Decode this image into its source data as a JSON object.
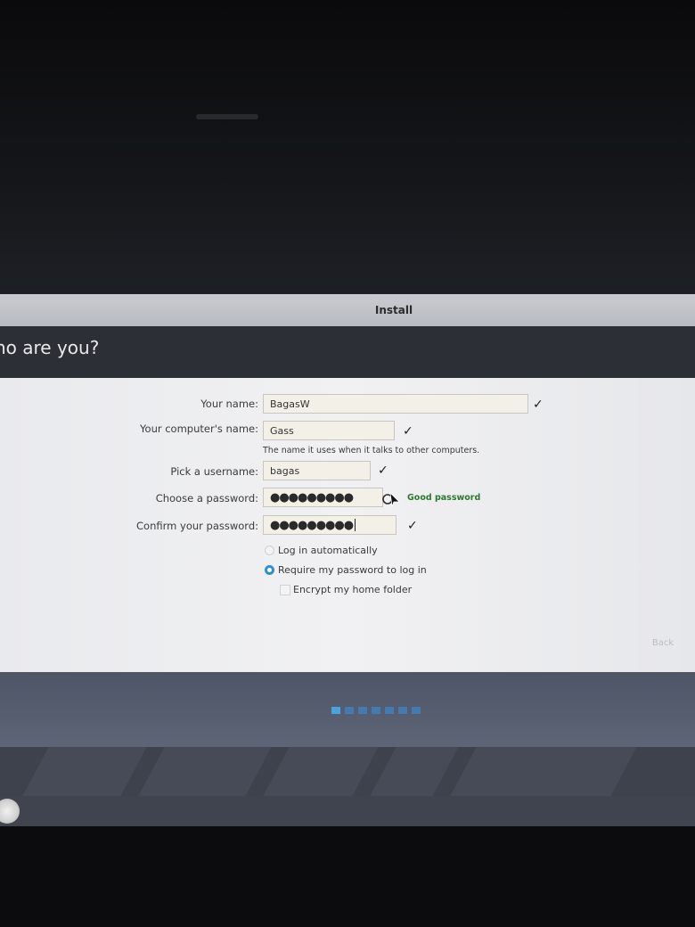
{
  "window": {
    "title": "Install"
  },
  "page": {
    "title": "ho are you?"
  },
  "form": {
    "name": {
      "label": "Your name:",
      "value": "BagasW"
    },
    "computer": {
      "label": "Your computer's name:",
      "value": "Gass",
      "hint": "The name it uses when it talks to other computers."
    },
    "username": {
      "label": "Pick a username:",
      "value": "bagas"
    },
    "password": {
      "label": "Choose a password:",
      "value": "●●●●●●●●●",
      "strength": "Good password"
    },
    "confirm": {
      "label": "Confirm your password:",
      "value": "●●●●●●●●●"
    },
    "login_options": [
      {
        "label": "Log in automatically",
        "selected": false
      },
      {
        "label": "Require my password to log in",
        "selected": true
      }
    ],
    "encrypt": {
      "label": "Encrypt my home folder",
      "checked": false
    }
  },
  "buttons": {
    "back": "Back"
  },
  "icons": {
    "check": "✓",
    "password_indicator": "password-strength-icon"
  },
  "progress": {
    "total_steps": 7,
    "current_step": 1
  },
  "colors": {
    "accent": "#2e8fd3",
    "progress_active": "#4aa3df",
    "progress_inactive": "#3d86c6"
  }
}
